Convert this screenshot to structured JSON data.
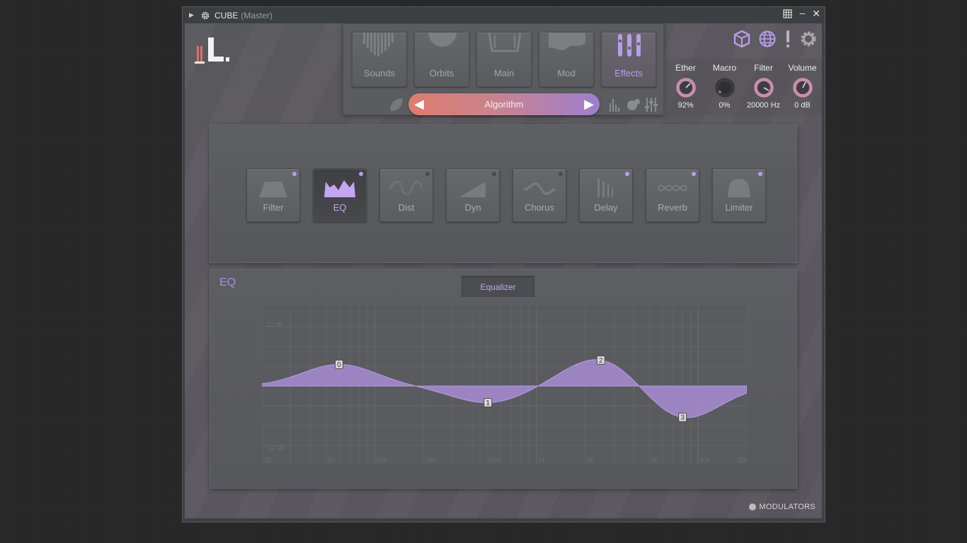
{
  "window": {
    "title": "CUBE",
    "subtitle": "(Master)"
  },
  "nav": {
    "tabs": [
      {
        "label": "Sounds"
      },
      {
        "label": "Orbits"
      },
      {
        "label": "Main"
      },
      {
        "label": "Mod"
      },
      {
        "label": "Effects",
        "active": true
      }
    ],
    "algorithm_label": "Algorithm"
  },
  "macros": [
    {
      "name": "Ether",
      "value": "92%"
    },
    {
      "name": "Macro",
      "value": "0%"
    },
    {
      "name": "Filter",
      "value": "20000 Hz"
    },
    {
      "name": "Volume",
      "value": "0 dB"
    }
  ],
  "effects": [
    {
      "label": "Filter",
      "enabled": true
    },
    {
      "label": "EQ",
      "enabled": true,
      "active": true
    },
    {
      "label": "Dist",
      "enabled": false
    },
    {
      "label": "Dyn",
      "enabled": false
    },
    {
      "label": "Chorus",
      "enabled": false
    },
    {
      "label": "Delay",
      "enabled": true
    },
    {
      "label": "Reverb",
      "enabled": true
    },
    {
      "label": "Limiter",
      "enabled": true
    }
  ],
  "eq": {
    "title": "EQ",
    "tab_label": "Equalizer",
    "db_top": "12 dB",
    "db_bottom": "-12 dB",
    "freq_labels": [
      "20",
      "50",
      "100",
      "200",
      "500",
      "1k",
      "2k",
      "5k",
      "10k",
      "20k"
    ],
    "bands": [
      {
        "id": "0",
        "freq": 60,
        "gain": 4.5
      },
      {
        "id": "1",
        "freq": 500,
        "gain": -3.5
      },
      {
        "id": "2",
        "freq": 2500,
        "gain": 6.0
      },
      {
        "id": "3",
        "freq": 8000,
        "gain": -7.0
      }
    ]
  },
  "footer": {
    "modulators_label": "MODULATORS"
  },
  "colors": {
    "accent": "#b79ee8",
    "algo_left": "#e07b6d",
    "algo_right": "#9f7ed0",
    "knob_ring": "#c88fa8"
  }
}
